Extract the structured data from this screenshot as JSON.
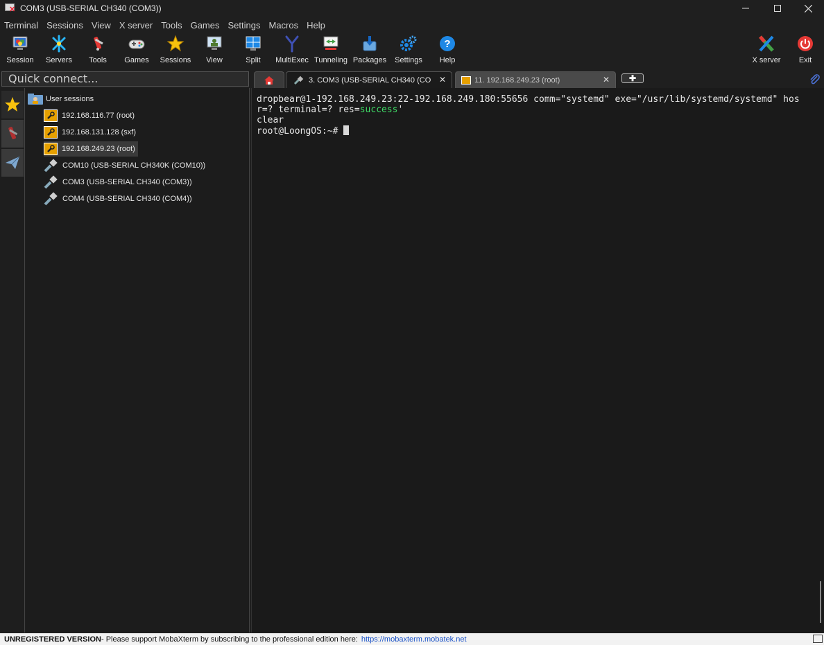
{
  "window": {
    "title": "COM3  (USB-SERIAL CH340 (COM3))",
    "controls": [
      "minimize",
      "maximize",
      "close"
    ]
  },
  "menu": [
    "Terminal",
    "Sessions",
    "View",
    "X server",
    "Tools",
    "Games",
    "Settings",
    "Macros",
    "Help"
  ],
  "toolbar": {
    "session": "Session",
    "servers": "Servers",
    "tools": "Tools",
    "games": "Games",
    "sessions": "Sessions",
    "view": "View",
    "split": "Split",
    "multiexec": "MultiExec",
    "tunneling": "Tunneling",
    "packages": "Packages",
    "settings": "Settings",
    "help": "Help",
    "xserver": "X server",
    "exit": "Exit"
  },
  "quick_connect": {
    "placeholder": "Quick connect..."
  },
  "tabs": {
    "com3": "3. COM3  (USB-SERIAL CH340 (CO",
    "ssh": "11. 192.168.249.23 (root)"
  },
  "sessions_tree": {
    "root": "User sessions",
    "items": [
      "192.168.116.77 (root)",
      "192.168.131.128 (sxf)",
      "192.168.249.23 (root)",
      "COM10  (USB-SERIAL CH340K (COM10))",
      "COM3  (USB-SERIAL CH340 (COM3))",
      "COM4  (USB-SERIAL CH340 (COM4))"
    ],
    "selected_index": 2
  },
  "terminal": {
    "line1": "dropbear@1-192.168.249.23:22-192.168.249.180:55656 comm=\"systemd\" exe=\"/usr/lib/systemd/systemd\" hos",
    "line2_pre": "r=? terminal=? res=",
    "line2_ok": "success",
    "line2_post": "'",
    "line3": "clear",
    "prompt": "root@LoongOS:~# "
  },
  "statusbar": {
    "unregistered": "UNREGISTERED VERSION",
    "message": "  -  Please support MobaXterm by subscribing to the professional edition here:",
    "link": "https://mobaxterm.mobatek.net"
  },
  "colors": {
    "background": "#1f1f1f",
    "terminal_bg": "#1a1a1a",
    "success_green": "#3fdc66",
    "session_icon_orange": "#e6a000",
    "exit_red": "#e53935",
    "help_blue": "#1e88e5"
  }
}
